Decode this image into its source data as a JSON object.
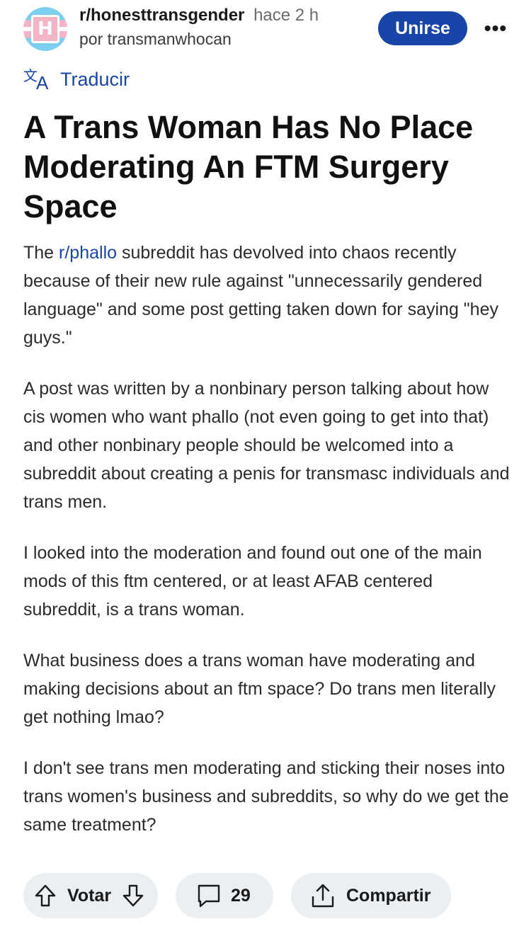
{
  "header": {
    "avatar_letter": "H",
    "subreddit": "r/honesttransgender",
    "time": "hace 2 h",
    "author": "por transmanwhocan",
    "join_label": "Unirse"
  },
  "translate_label": "Traducir",
  "post": {
    "title": "A Trans Woman Has No Place Moderating An FTM Surgery Space",
    "p1_pre": "The ",
    "p1_link": "r/phallo",
    "p1_post": " subreddit has devolved into chaos recently because of their new rule against \"unnecessarily gendered language\" and some post getting taken down for saying \"hey guys.\"",
    "p2": "A post was written by a nonbinary person talking about how cis women who want phallo (not even going to get into that) and other nonbinary people should be welcomed into a subreddit about creating a penis for transmasc individuals and trans men.",
    "p3": "I looked into the moderation and found out one of the main mods of this ftm centered, or at least AFAB centered subreddit, is a trans woman.",
    "p4": "What business does a trans woman have moderating and making decisions about an ftm space? Do trans men literally get nothing lmao?",
    "p5": "I don't see trans men moderating and sticking their noses into trans women's business and subreddits, so why do we get the same treatment?"
  },
  "actions": {
    "vote_label": "Votar",
    "comment_count": "29",
    "share_label": "Compartir"
  },
  "colors": {
    "accent": "#1a45a8",
    "pill_bg": "#eceff1"
  },
  "icons": [
    "translate-icon",
    "more-icon",
    "upvote-icon",
    "downvote-icon",
    "comment-icon",
    "share-icon"
  ]
}
